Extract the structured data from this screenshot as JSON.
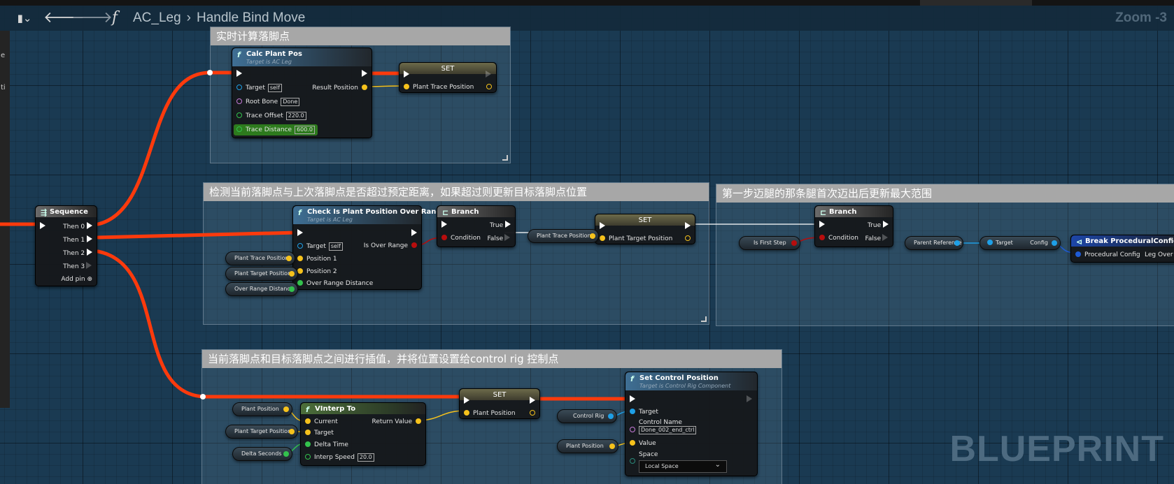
{
  "toolbar": {
    "bookmark_icon": "bookmark-icon",
    "back_icon": "arrow-left-icon",
    "forward_icon": "arrow-right-icon",
    "function_icon": "f",
    "breadcrumb": [
      "AC_Leg",
      "Handle Bind Move"
    ],
    "zoom": "Zoom -3"
  },
  "left_panel": {
    "letters": [
      "e",
      "ti"
    ]
  },
  "comments": {
    "c1": "实时计算落脚点",
    "c2": "检测当前落脚点与上次落脚点是否超过预定距离，如果超过则更新目标落脚点位置",
    "c3": "第一步迈腿的那条腿首次迈出后更新最大范围",
    "c4": "当前落脚点和目标落脚点之间进行插值，并将位置设置给control rig 控制点"
  },
  "nodes": {
    "sequence": {
      "title": "Sequence",
      "pins": [
        "Then 0",
        "Then 1",
        "Then 2",
        "Then 3"
      ],
      "add_pin": "Add pin"
    },
    "calc": {
      "title": "Calc Plant Pos",
      "subtitle": "Target is AC Leg",
      "target": "Target",
      "target_val": "self",
      "root": "Root Bone",
      "root_val": "Done",
      "offset": "Trace Offset",
      "offset_val": "220.0",
      "distance": "Trace Distance",
      "distance_val": "600.0",
      "result": "Result Position"
    },
    "set1": {
      "title": "SET",
      "pin": "Plant Trace Position"
    },
    "check": {
      "title": "Check Is Plant Position Over Range",
      "subtitle": "Target is AC Leg",
      "target": "Target",
      "target_val": "self",
      "p1": "Position 1",
      "p2": "Position 2",
      "ord": "Over Range Distance",
      "out": "Is Over Range"
    },
    "branch1": {
      "title": "Branch",
      "cond": "Condition",
      "t": "True",
      "f": "False"
    },
    "set2": {
      "title": "SET",
      "pin": "Plant Target Position"
    },
    "branch2": {
      "title": "Branch",
      "cond": "Condition",
      "t": "True",
      "f": "False"
    },
    "vinterp": {
      "title": "VInterp To",
      "current": "Current",
      "target": "Target",
      "dt": "Delta Time",
      "speed": "Interp Speed",
      "speed_val": "20.0",
      "ret": "Return Value"
    },
    "set3": {
      "title": "SET",
      "pin": "Plant Position"
    },
    "scp": {
      "title": "Set Control Position",
      "subtitle": "Target is Control Rig Component",
      "target": "Target",
      "cname": "Control Name",
      "cname_val": "Done_002_end_ctrl",
      "value": "Value",
      "space": "Space",
      "space_val": "Local Space"
    },
    "break": {
      "title": "Break ProceduralConfig",
      "pin_in": "Procedural Config",
      "pin_out": "Leg Over R"
    },
    "getcfg": {
      "target": "Target",
      "config": "Config"
    }
  },
  "getters": {
    "g_ptp1": "Plant Trace Position",
    "g_ptgp1": "Plant Target Position",
    "g_ord": "Over Range Distance",
    "g_ptp2": "Plant Trace Position",
    "g_first": "Is First Step",
    "g_parent": "Parent Reference",
    "g_pp": "Plant Position",
    "g_ptgp2": "Plant Target Position",
    "g_dsec": "Delta Seconds",
    "g_cr": "Control Rig",
    "g_pp2": "Plant Position"
  },
  "watermark": "BLUEPRINT",
  "colors": {
    "exec_wire": "#ff3a0c",
    "vector": "#f6c21c",
    "bool": "#b80d0d",
    "float": "#33c24d",
    "object": "#1e9fe6",
    "name": "#c77bd9",
    "struct": "#1e5bd6"
  }
}
